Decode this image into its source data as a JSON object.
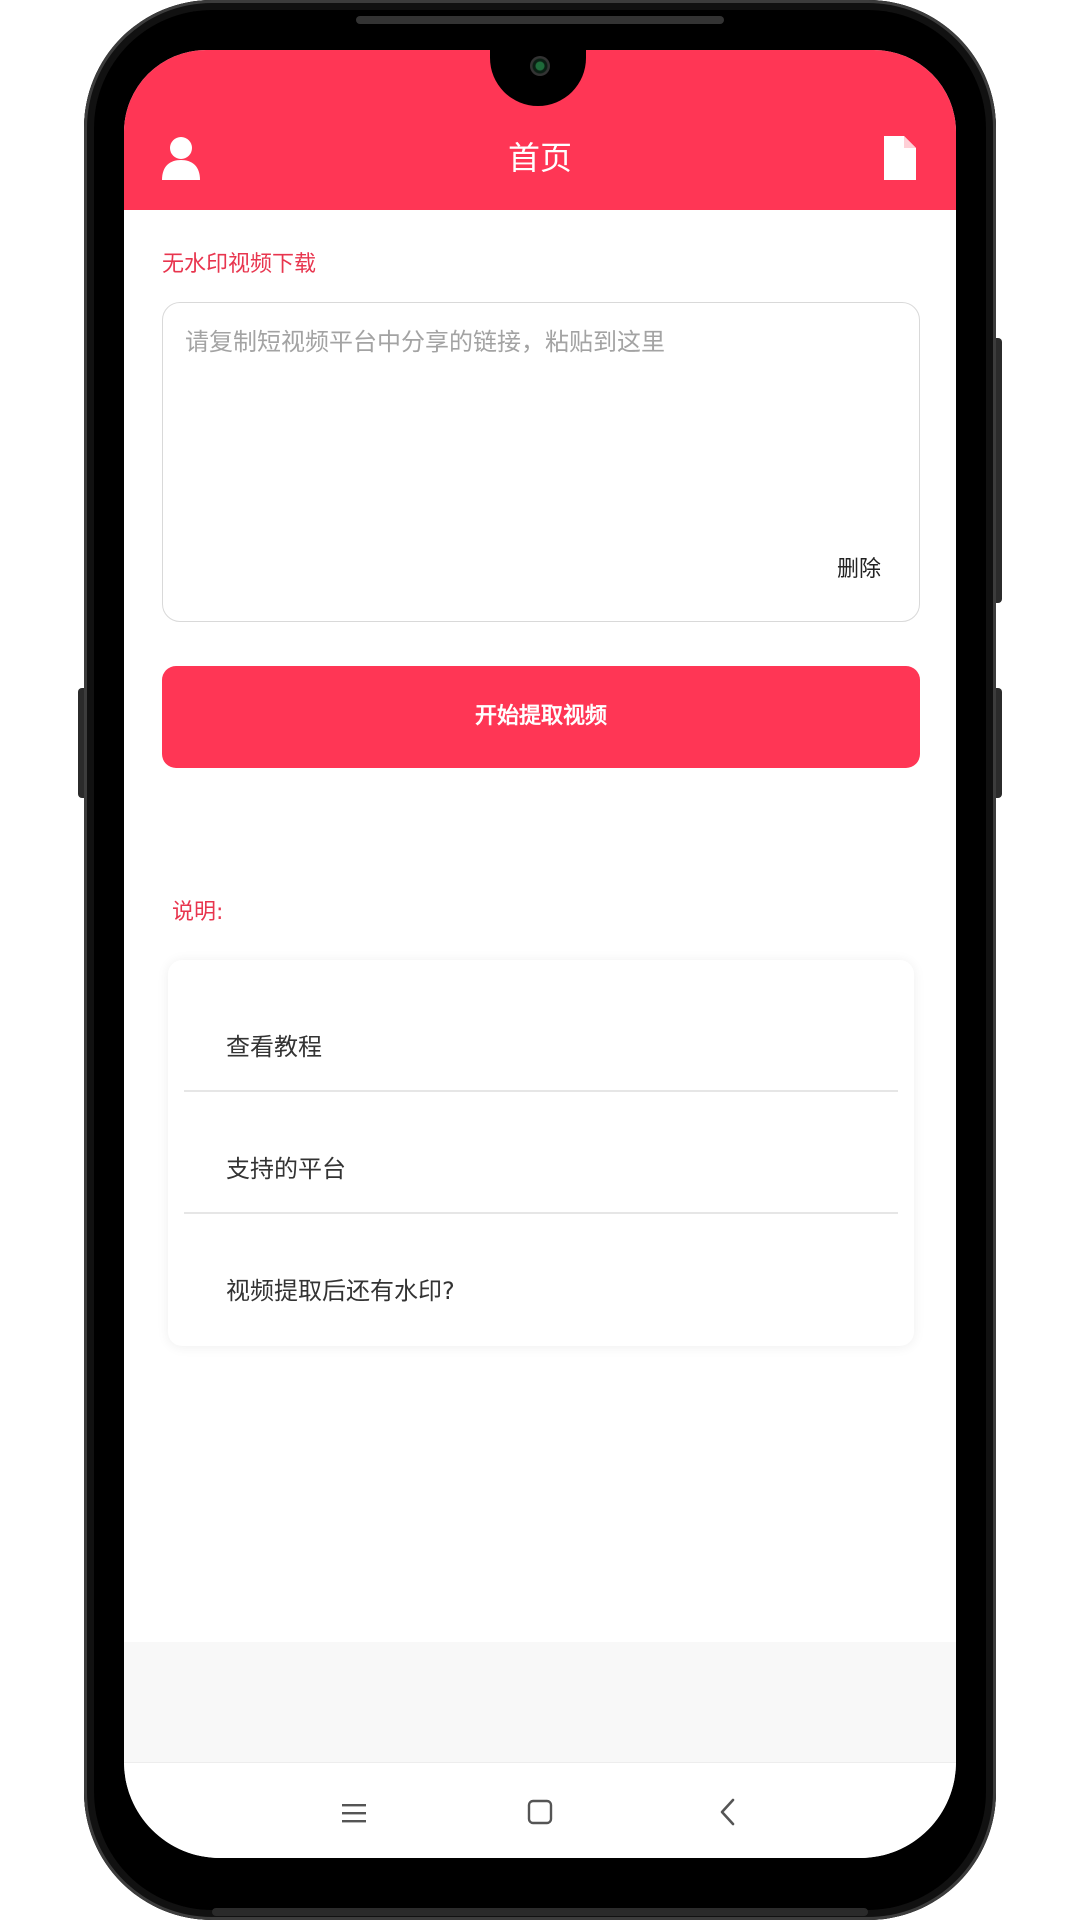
{
  "header": {
    "title": "首页",
    "left_icon": "user-icon",
    "right_icon": "document-icon",
    "color": "#ff3655"
  },
  "download": {
    "section_title": "无水印视频下载",
    "placeholder": "请复制短视频平台中分享的链接，粘贴到这里",
    "delete_label": "删除",
    "start_button_label": "开始提取视频"
  },
  "notes": {
    "title": "说明:",
    "items": [
      {
        "label": "查看教程"
      },
      {
        "label": "支持的平台"
      },
      {
        "label": "视频提取后还有水印?"
      }
    ]
  },
  "system_nav": {
    "menu_icon": "menu-icon",
    "home_icon": "home-icon",
    "back_icon": "back-icon"
  },
  "colors": {
    "accent": "#ff3655",
    "section_text": "#e8354e"
  }
}
